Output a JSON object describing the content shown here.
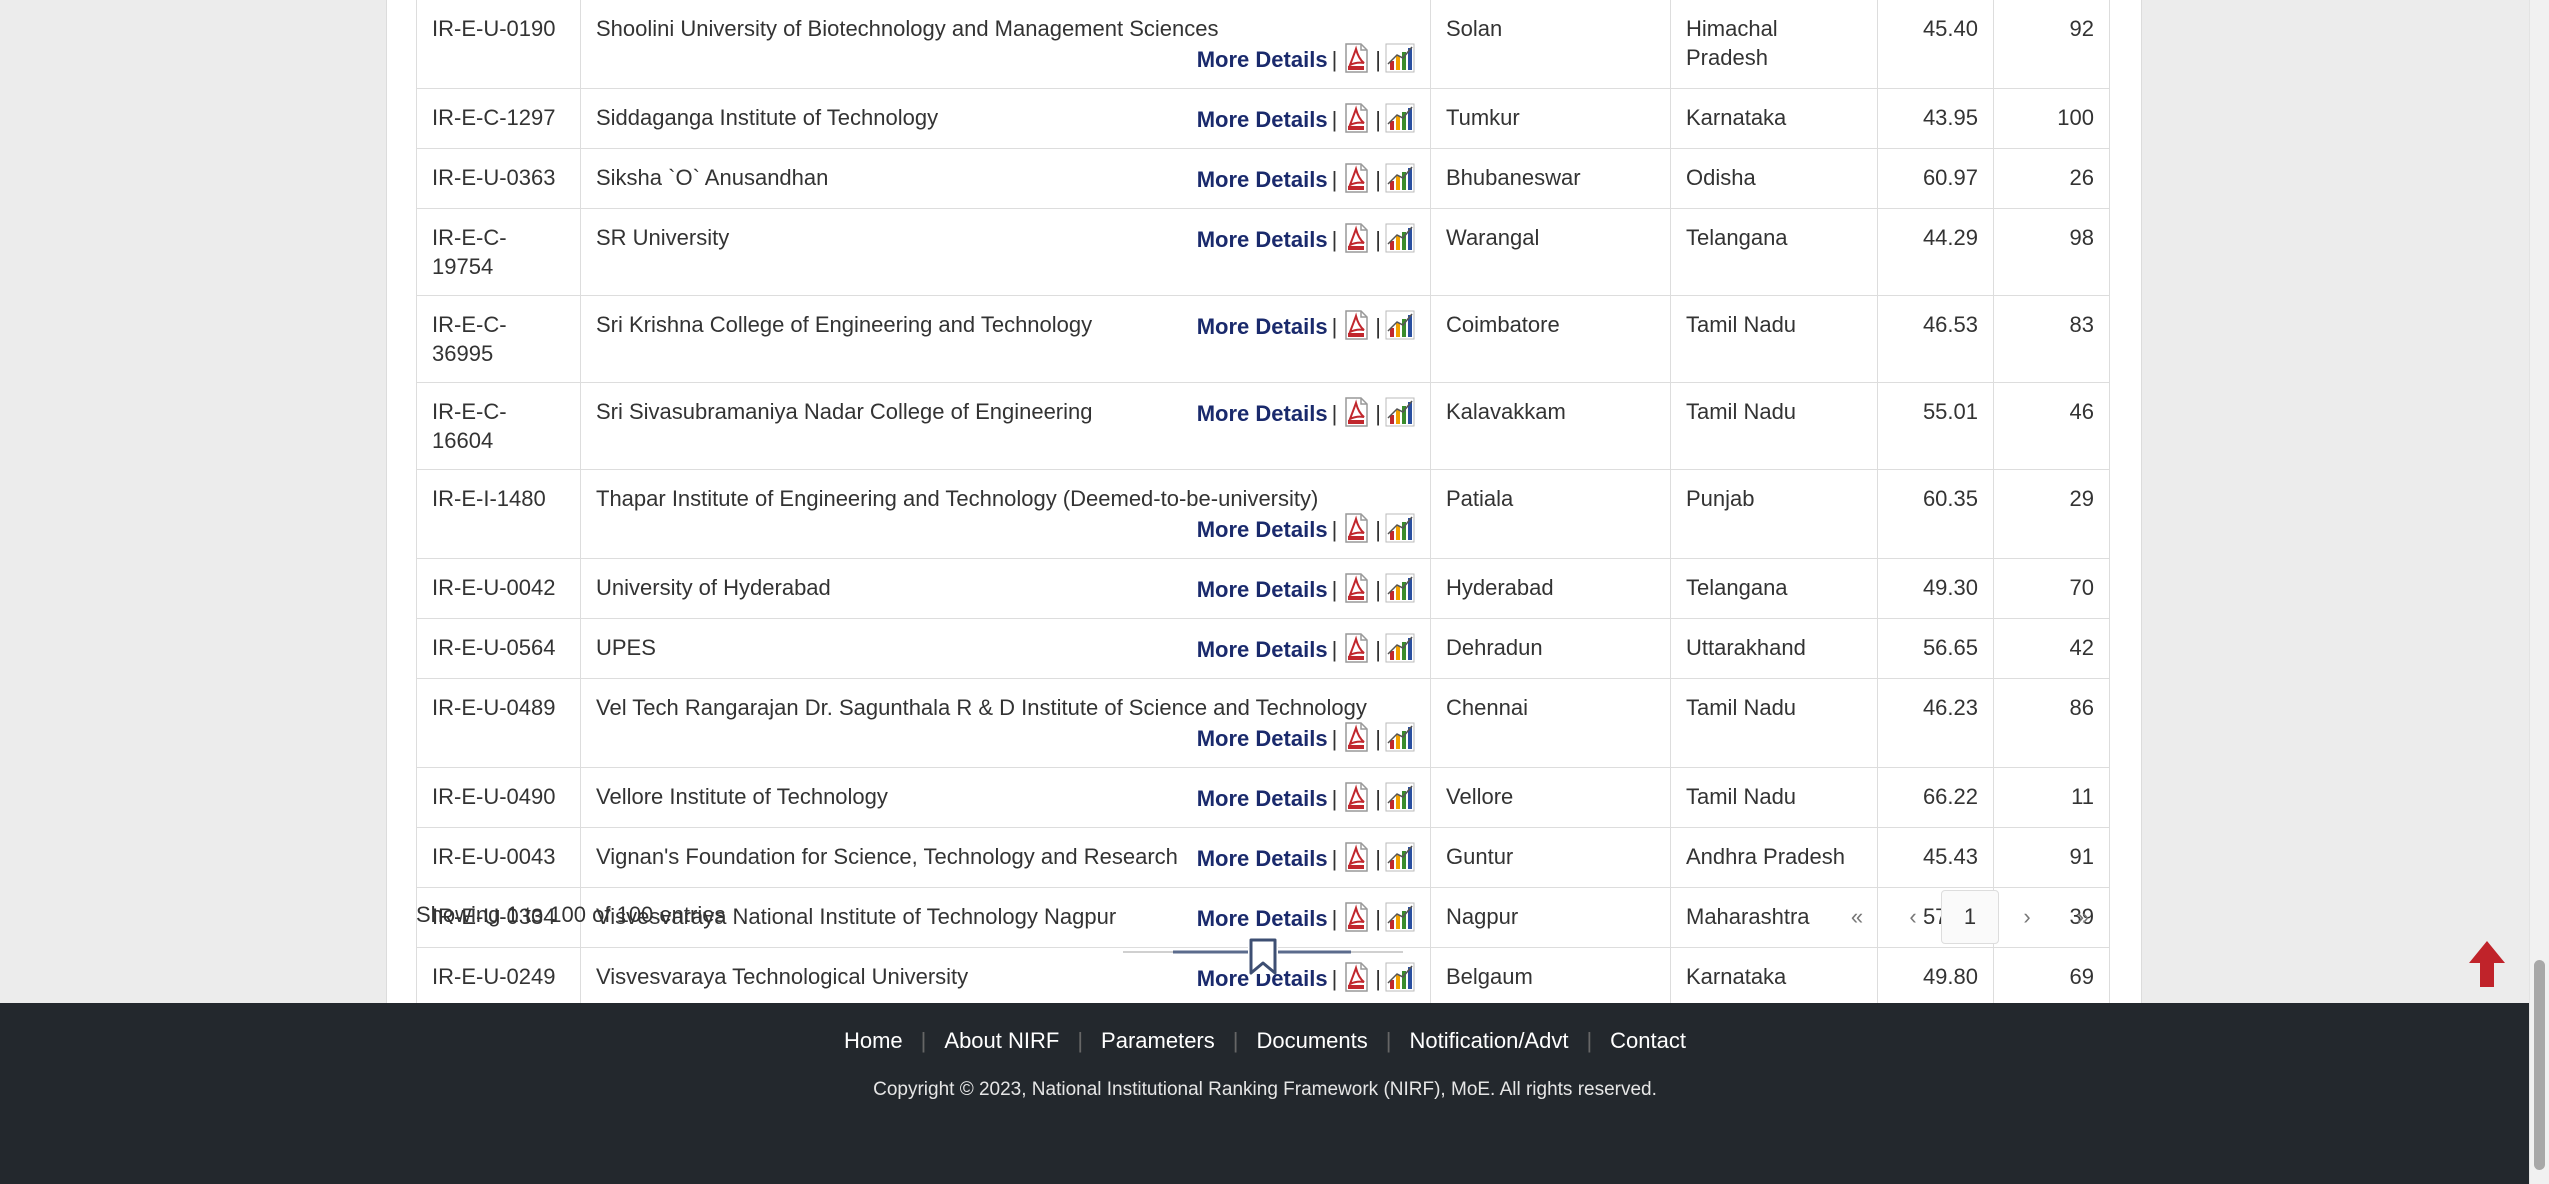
{
  "table": {
    "rows": [
      {
        "id": "IR-E-U-0190",
        "name": "Shoolini University of Biotechnology and Management Sciences",
        "city": "Solan",
        "state": "Himachal Pradesh",
        "score": "45.40",
        "rank": "92",
        "wrap": true
      },
      {
        "id": "IR-E-C-1297",
        "name": "Siddaganga Institute of Technology",
        "city": "Tumkur",
        "state": "Karnataka",
        "score": "43.95",
        "rank": "100",
        "wrap": false
      },
      {
        "id": "IR-E-U-0363",
        "name": "Siksha `O` Anusandhan",
        "city": "Bhubaneswar",
        "state": "Odisha",
        "score": "60.97",
        "rank": "26",
        "wrap": false
      },
      {
        "id": "IR-E-C-19754",
        "name": "SR University",
        "city": "Warangal",
        "state": "Telangana",
        "score": "44.29",
        "rank": "98",
        "wrap": false
      },
      {
        "id": "IR-E-C-36995",
        "name": "Sri Krishna College of Engineering and Technology",
        "city": "Coimbatore",
        "state": "Tamil Nadu",
        "score": "46.53",
        "rank": "83",
        "wrap": false
      },
      {
        "id": "IR-E-C-16604",
        "name": "Sri Sivasubramaniya Nadar College of Engineering",
        "city": "Kalavakkam",
        "state": "Tamil Nadu",
        "score": "55.01",
        "rank": "46",
        "wrap": false
      },
      {
        "id": "IR-E-I-1480",
        "name": "Thapar Institute of Engineering and Technology (Deemed-to-be-university)",
        "city": "Patiala",
        "state": "Punjab",
        "score": "60.35",
        "rank": "29",
        "wrap": true
      },
      {
        "id": "IR-E-U-0042",
        "name": "University of Hyderabad",
        "city": "Hyderabad",
        "state": "Telangana",
        "score": "49.30",
        "rank": "70",
        "wrap": false
      },
      {
        "id": "IR-E-U-0564",
        "name": "UPES",
        "city": "Dehradun",
        "state": "Uttarakhand",
        "score": "56.65",
        "rank": "42",
        "wrap": false
      },
      {
        "id": "IR-E-U-0489",
        "name": "Vel Tech Rangarajan Dr. Sagunthala R & D Institute of Science and Technology",
        "city": "Chennai",
        "state": "Tamil Nadu",
        "score": "46.23",
        "rank": "86",
        "wrap": true
      },
      {
        "id": "IR-E-U-0490",
        "name": "Vellore Institute of Technology",
        "city": "Vellore",
        "state": "Tamil Nadu",
        "score": "66.22",
        "rank": "11",
        "wrap": false
      },
      {
        "id": "IR-E-U-0043",
        "name": "Vignan's Foundation for Science, Technology and Research",
        "city": "Guntur",
        "state": "Andhra Pradesh",
        "score": "45.43",
        "rank": "91",
        "wrap": false
      },
      {
        "id": "IR-E-U-0334",
        "name": "Visvesvaraya National Institute of Technology Nagpur",
        "city": "Nagpur",
        "state": "Maharashtra",
        "score": "57.89",
        "rank": "39",
        "wrap": false
      },
      {
        "id": "IR-E-U-0249",
        "name": "Visvesvaraya Technological University",
        "city": "Belgaum",
        "state": "Karnataka",
        "score": "49.80",
        "rank": "69",
        "wrap": false
      }
    ],
    "more_details_label": "More Details",
    "separator": "|",
    "pdf_icon": "pdf-icon",
    "graph_icon": "bar-chart-icon"
  },
  "info": {
    "text": "Showing 1 to 100 of 100 entries"
  },
  "pagination": {
    "first": "«",
    "prev": "‹",
    "current": "1",
    "next": "›",
    "last": "»"
  },
  "bookmark_icon": "bookmark-icon",
  "back_to_top_icon": "arrow-up-icon",
  "footer": {
    "nav": [
      "Home",
      "About NIRF",
      "Parameters",
      "Documents",
      "Notification/Advt",
      "Contact"
    ],
    "copyright": "Copyright © 2023, National Institutional Ranking Framework (NIRF), MoE. All rights reserved."
  },
  "colors": {
    "link": "#1a2a6c",
    "footer_bg": "#23282d",
    "pdf_red": "#c1272d",
    "top_arrow": "#c0232a"
  }
}
